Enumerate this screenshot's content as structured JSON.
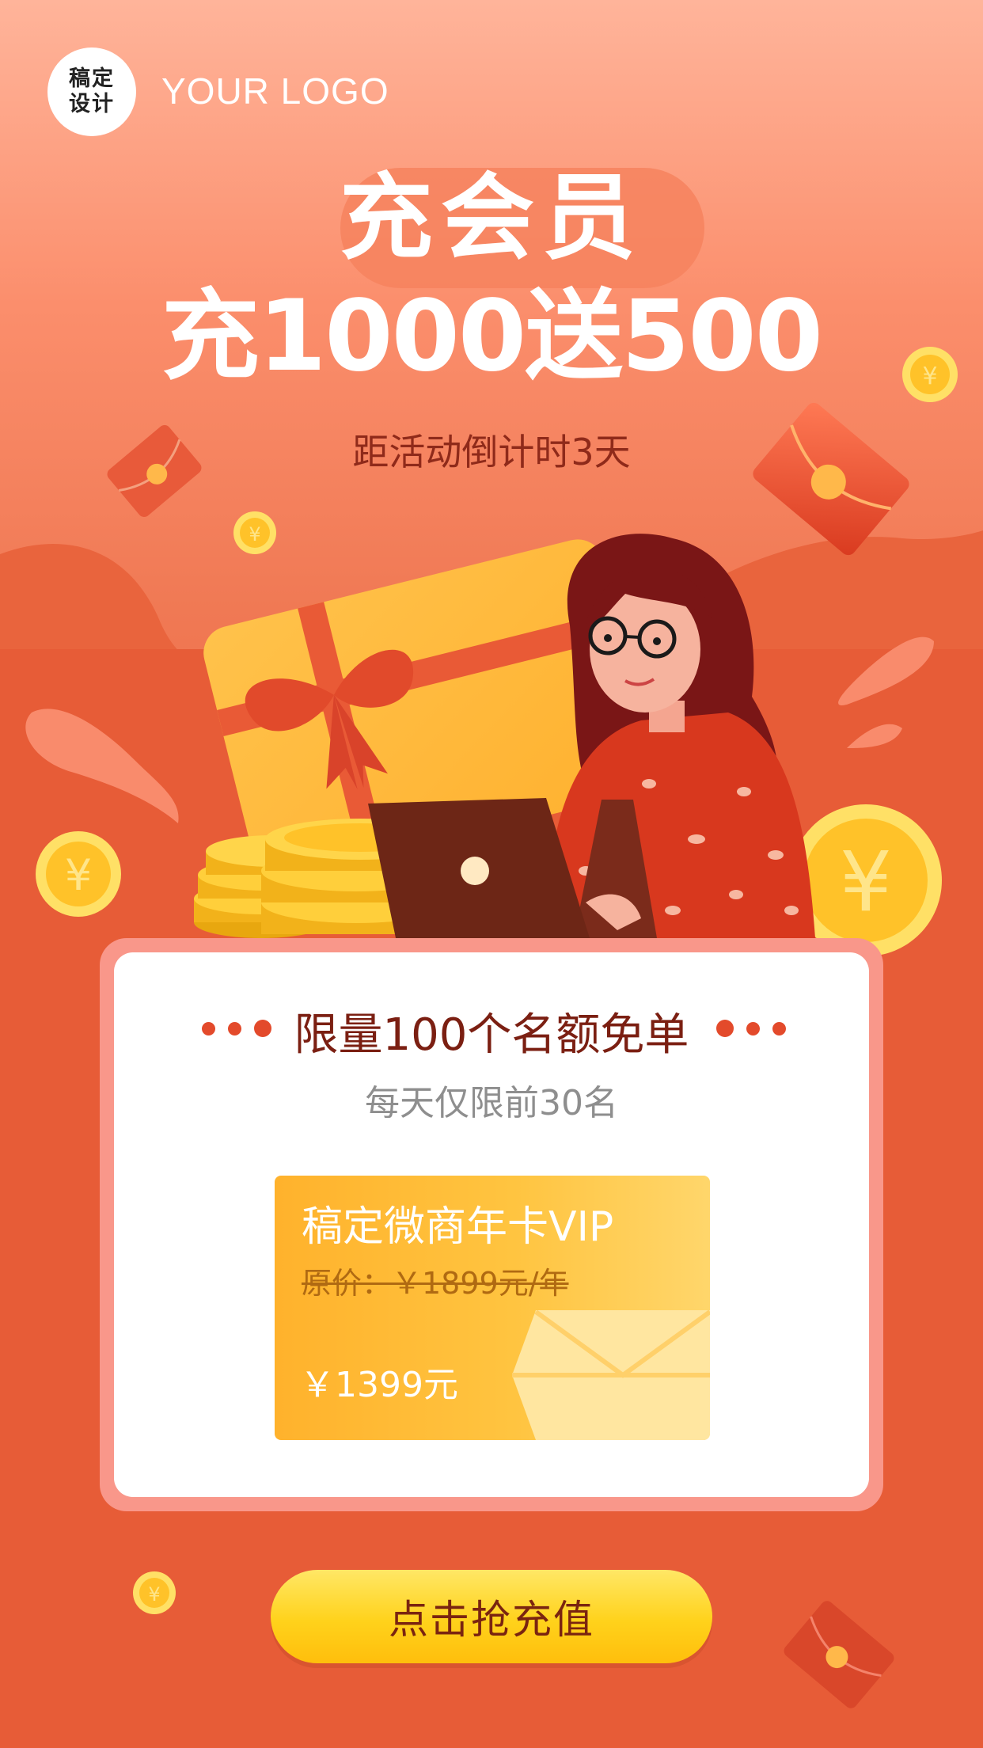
{
  "brand": {
    "logo_line1": "稿定",
    "logo_line2": "设计",
    "logo_text": "YOUR LOGO"
  },
  "headline": {
    "line1": "充会员",
    "line2": "充1000送500",
    "countdown": "距活动倒计时3天"
  },
  "card": {
    "title": "限量100个名额免单",
    "subtitle": "每天仅限前30名",
    "vip": {
      "name": "稿定微商年卡VIP",
      "original_price": "原价：￥1899元/年",
      "price": "￥1399元"
    }
  },
  "cta": {
    "label": "点击抢充值"
  },
  "icons": {
    "coin_symbol": "¥"
  },
  "colors": {
    "background": "#e75c37",
    "accent_red": "#e34a2b",
    "gold": "#ffc440",
    "title_dark": "#7b1f12"
  }
}
